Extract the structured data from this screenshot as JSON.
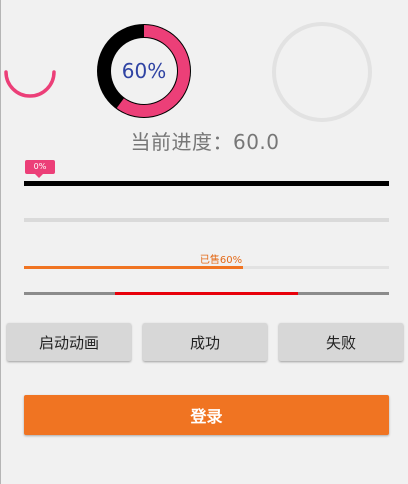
{
  "colors": {
    "pink": "#ec3f78",
    "indigo": "#2f43a3",
    "orange": "#f07422",
    "red": "#e8000a",
    "grey_ring": "#e2e2e2"
  },
  "circle_progress": {
    "spinner_fraction": 0.5,
    "main_percent_label": "60%",
    "main_fraction": 0.6,
    "empty_ring_fraction": 0
  },
  "progress_text": "当前进度：60.0",
  "bars": {
    "tag_label": "0%",
    "black_bar_fraction": 1.0,
    "empty_bar_fraction": 0,
    "sold_label": "已售60%",
    "orange_fraction": 0.6,
    "secondary_start_fraction": 0.25,
    "secondary_end_fraction": 0.75
  },
  "buttons": {
    "start": "启动动画",
    "success": "成功",
    "fail": "失败",
    "login": "登录"
  }
}
